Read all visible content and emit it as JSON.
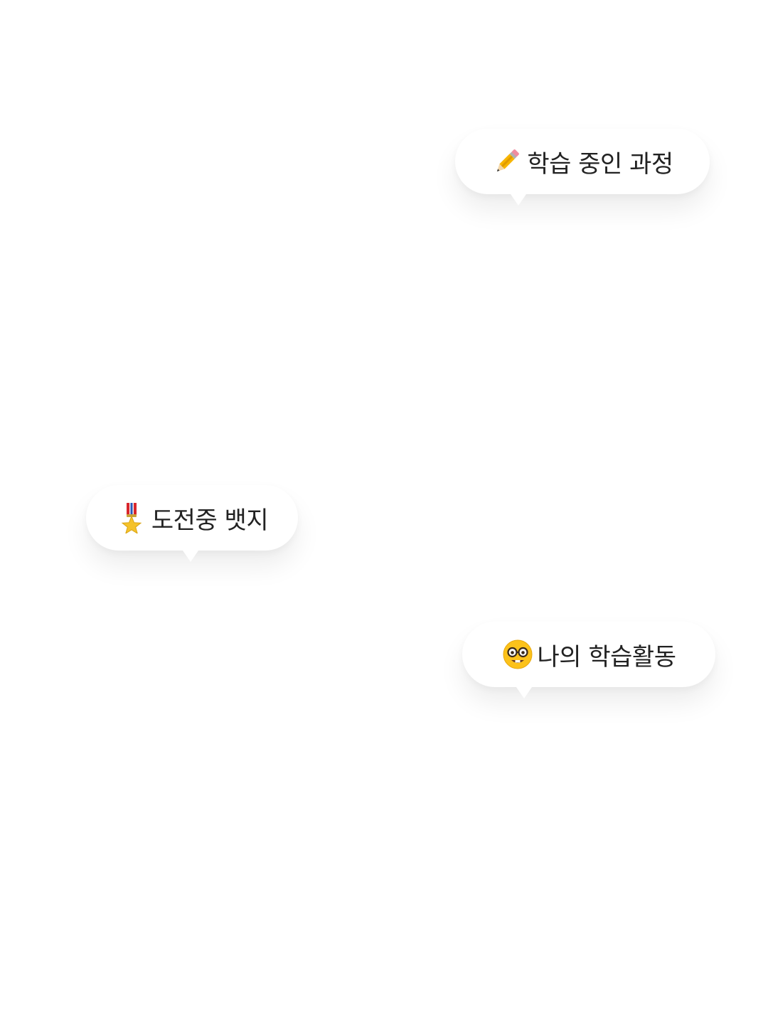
{
  "bubbles": [
    {
      "icon": "pencil-icon",
      "label": "학습 중인 과정"
    },
    {
      "icon": "medal-icon",
      "label": "도전중 뱃지"
    },
    {
      "icon": "nerd-face-icon",
      "label": "나의 학습활동"
    }
  ],
  "colors": {
    "background": "#ffffff",
    "bubble": "#ffffff",
    "text": "#222222"
  }
}
